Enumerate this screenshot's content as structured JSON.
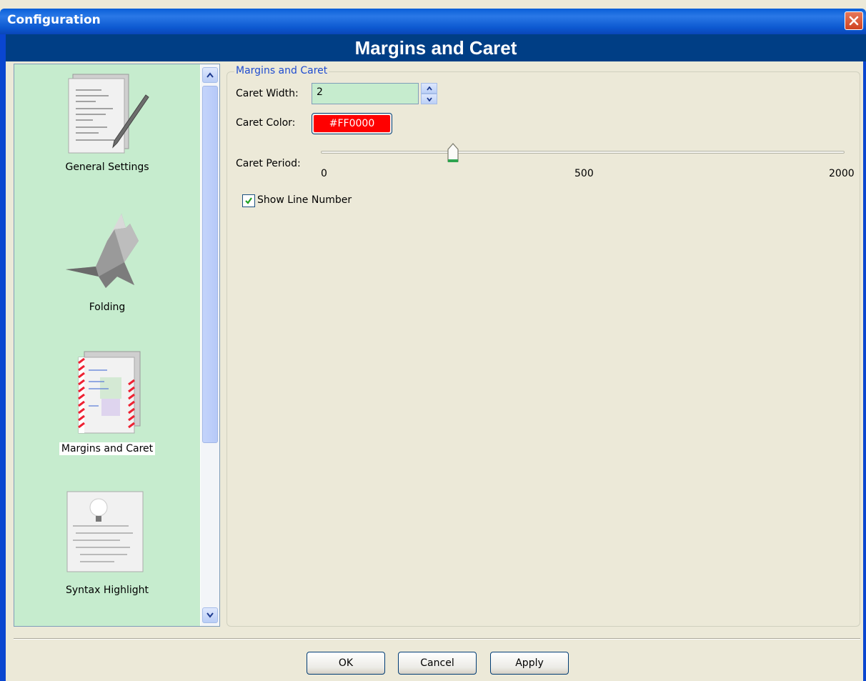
{
  "window": {
    "title": "Configuration",
    "header": "Margins and Caret"
  },
  "sidebar": {
    "items": [
      {
        "label": "General Settings",
        "icon": "document-pen-icon"
      },
      {
        "label": "Folding",
        "icon": "origami-bird-icon"
      },
      {
        "label": "Margins and Caret",
        "icon": "document-margins-icon",
        "selected": true
      },
      {
        "label": "Syntax Highlight",
        "icon": "document-lightbulb-icon"
      }
    ]
  },
  "group": {
    "legend": "Margins and Caret",
    "caret_width_label": "Caret Width:",
    "caret_width_value": "2",
    "caret_color_label": "Caret Color:",
    "caret_color_value": "#FF0000",
    "caret_period_label": "Caret Period:",
    "caret_period_ticks": [
      "0",
      "500",
      "2000"
    ],
    "caret_period_value_fraction": 0.25,
    "show_line_number_label": "Show Line Number",
    "show_line_number_checked": true
  },
  "buttons": {
    "ok": "OK",
    "cancel": "Cancel",
    "apply": "Apply"
  }
}
